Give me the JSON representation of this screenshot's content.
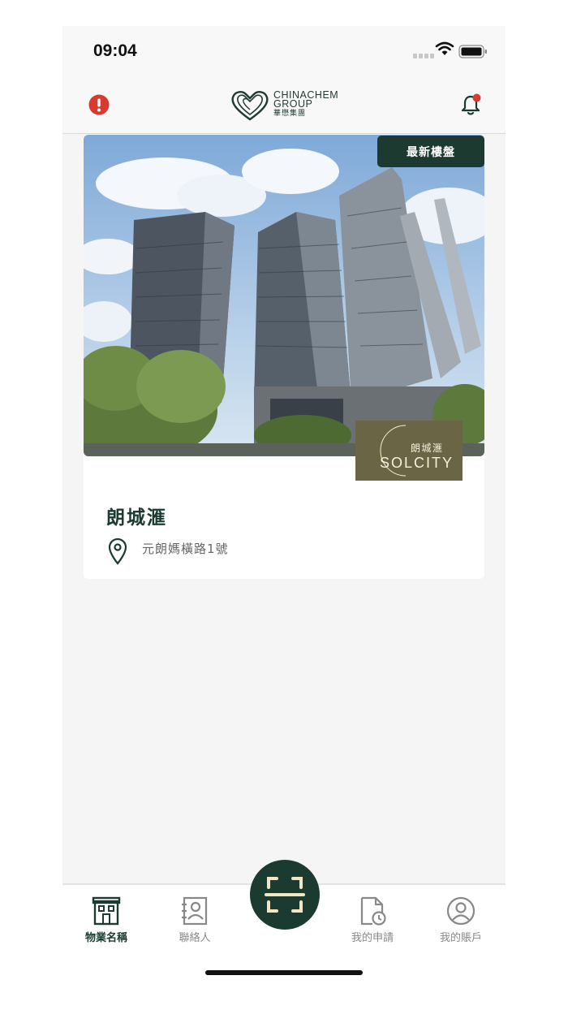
{
  "status_bar": {
    "time": "09:04"
  },
  "header": {
    "logo_en": "CHINACHEM",
    "logo_en2": "GROUP",
    "logo_cn": "華懋集團"
  },
  "card": {
    "badge": "最新樓盤",
    "project_logo_cn": "朗城滙",
    "project_logo_en": "SOLCITY",
    "name": "朗城滙",
    "address": "元朗媽橫路1號"
  },
  "tabs": [
    {
      "label": "物業名稱",
      "icon": "building-icon",
      "active": true
    },
    {
      "label": "聯絡人",
      "icon": "contacts-icon",
      "active": false
    },
    {
      "label": "我的申請",
      "icon": "application-icon",
      "active": false
    },
    {
      "label": "我的賬戶",
      "icon": "account-icon",
      "active": false
    }
  ],
  "colors": {
    "brand_dark_green": "#1b3a30",
    "alert_red": "#d83a2f",
    "project_olive": "#6a6544"
  }
}
